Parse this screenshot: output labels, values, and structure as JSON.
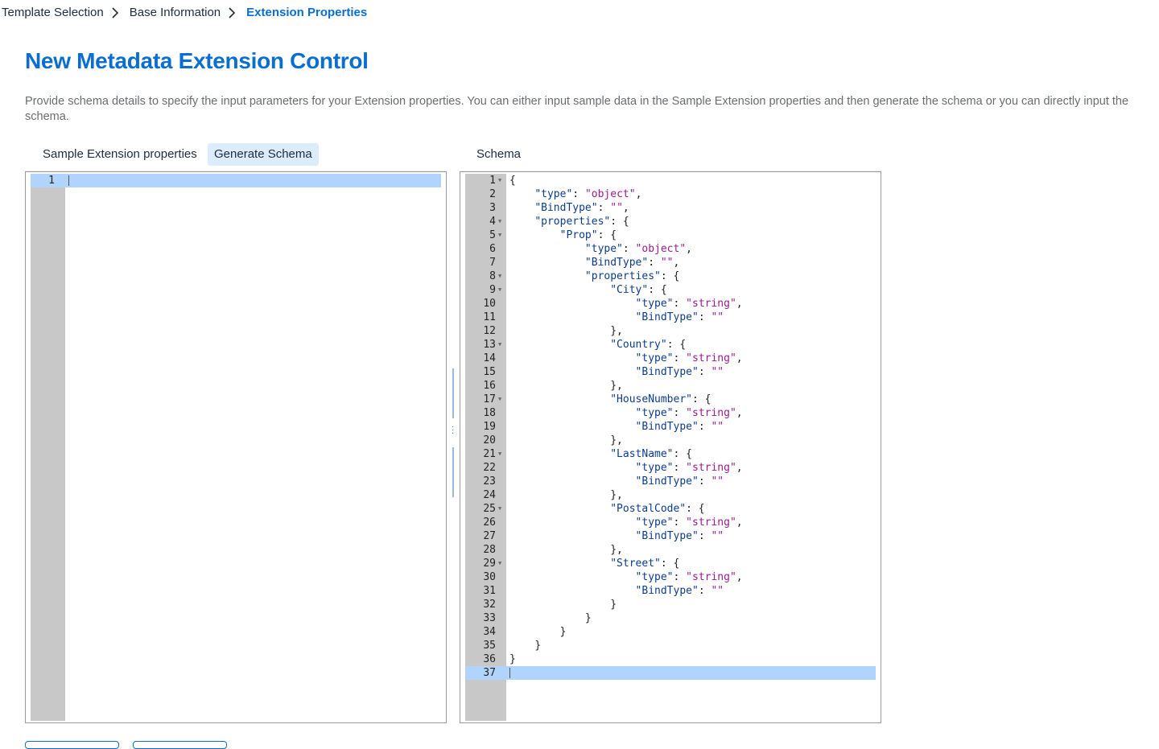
{
  "breadcrumb": {
    "items": [
      "Template Selection",
      "Base Information"
    ],
    "current": "Extension Properties"
  },
  "page": {
    "title": "New Metadata Extension Control",
    "description": "Provide schema details to specify the input parameters for your Extension properties. You can either input sample data in the Sample Extension properties and then generate the schema or you can directly input the schema."
  },
  "left_panel": {
    "tab_label": "Sample Extension properties",
    "generate_button": "Generate Schema",
    "editor": {
      "line_numbers": [
        "1"
      ],
      "active_line": 1
    }
  },
  "right_panel": {
    "tab_label": "Schema",
    "editor": {
      "active_line": 37,
      "lines": [
        {
          "n": "1",
          "fold": true,
          "indent": 0,
          "tokens": [
            [
              "p",
              "{"
            ]
          ]
        },
        {
          "n": "2",
          "indent": 1,
          "tokens": [
            [
              "k",
              "\"type\""
            ],
            [
              "p",
              ": "
            ],
            [
              "s",
              "\"object\""
            ],
            [
              "p",
              ","
            ]
          ]
        },
        {
          "n": "3",
          "indent": 1,
          "tokens": [
            [
              "k",
              "\"BindType\""
            ],
            [
              "p",
              ": "
            ],
            [
              "s",
              "\"\""
            ],
            [
              "p",
              ","
            ]
          ]
        },
        {
          "n": "4",
          "fold": true,
          "indent": 1,
          "tokens": [
            [
              "k",
              "\"properties\""
            ],
            [
              "p",
              ": {"
            ]
          ]
        },
        {
          "n": "5",
          "fold": true,
          "indent": 2,
          "tokens": [
            [
              "k",
              "\"Prop\""
            ],
            [
              "p",
              ": {"
            ]
          ]
        },
        {
          "n": "6",
          "indent": 3,
          "tokens": [
            [
              "k",
              "\"type\""
            ],
            [
              "p",
              ": "
            ],
            [
              "s",
              "\"object\""
            ],
            [
              "p",
              ","
            ]
          ]
        },
        {
          "n": "7",
          "indent": 3,
          "tokens": [
            [
              "k",
              "\"BindType\""
            ],
            [
              "p",
              ": "
            ],
            [
              "s",
              "\"\""
            ],
            [
              "p",
              ","
            ]
          ]
        },
        {
          "n": "8",
          "fold": true,
          "indent": 3,
          "tokens": [
            [
              "k",
              "\"properties\""
            ],
            [
              "p",
              ": {"
            ]
          ]
        },
        {
          "n": "9",
          "fold": true,
          "indent": 4,
          "tokens": [
            [
              "k",
              "\"City\""
            ],
            [
              "p",
              ": {"
            ]
          ]
        },
        {
          "n": "10",
          "indent": 5,
          "tokens": [
            [
              "k",
              "\"type\""
            ],
            [
              "p",
              ": "
            ],
            [
              "s",
              "\"string\""
            ],
            [
              "p",
              ","
            ]
          ]
        },
        {
          "n": "11",
          "indent": 5,
          "tokens": [
            [
              "k",
              "\"BindType\""
            ],
            [
              "p",
              ": "
            ],
            [
              "s",
              "\"\""
            ]
          ]
        },
        {
          "n": "12",
          "indent": 4,
          "tokens": [
            [
              "p",
              "},"
            ]
          ]
        },
        {
          "n": "13",
          "fold": true,
          "indent": 4,
          "tokens": [
            [
              "k",
              "\"Country\""
            ],
            [
              "p",
              ": {"
            ]
          ]
        },
        {
          "n": "14",
          "indent": 5,
          "tokens": [
            [
              "k",
              "\"type\""
            ],
            [
              "p",
              ": "
            ],
            [
              "s",
              "\"string\""
            ],
            [
              "p",
              ","
            ]
          ]
        },
        {
          "n": "15",
          "indent": 5,
          "tokens": [
            [
              "k",
              "\"BindType\""
            ],
            [
              "p",
              ": "
            ],
            [
              "s",
              "\"\""
            ]
          ]
        },
        {
          "n": "16",
          "indent": 4,
          "tokens": [
            [
              "p",
              "},"
            ]
          ]
        },
        {
          "n": "17",
          "fold": true,
          "indent": 4,
          "tokens": [
            [
              "k",
              "\"HouseNumber\""
            ],
            [
              "p",
              ": {"
            ]
          ]
        },
        {
          "n": "18",
          "indent": 5,
          "tokens": [
            [
              "k",
              "\"type\""
            ],
            [
              "p",
              ": "
            ],
            [
              "s",
              "\"string\""
            ],
            [
              "p",
              ","
            ]
          ]
        },
        {
          "n": "19",
          "indent": 5,
          "tokens": [
            [
              "k",
              "\"BindType\""
            ],
            [
              "p",
              ": "
            ],
            [
              "s",
              "\"\""
            ]
          ]
        },
        {
          "n": "20",
          "indent": 4,
          "tokens": [
            [
              "p",
              "},"
            ]
          ]
        },
        {
          "n": "21",
          "fold": true,
          "indent": 4,
          "tokens": [
            [
              "k",
              "\"LastName\""
            ],
            [
              "p",
              ": {"
            ]
          ]
        },
        {
          "n": "22",
          "indent": 5,
          "tokens": [
            [
              "k",
              "\"type\""
            ],
            [
              "p",
              ": "
            ],
            [
              "s",
              "\"string\""
            ],
            [
              "p",
              ","
            ]
          ]
        },
        {
          "n": "23",
          "indent": 5,
          "tokens": [
            [
              "k",
              "\"BindType\""
            ],
            [
              "p",
              ": "
            ],
            [
              "s",
              "\"\""
            ]
          ]
        },
        {
          "n": "24",
          "indent": 4,
          "tokens": [
            [
              "p",
              "},"
            ]
          ]
        },
        {
          "n": "25",
          "fold": true,
          "indent": 4,
          "tokens": [
            [
              "k",
              "\"PostalCode\""
            ],
            [
              "p",
              ": {"
            ]
          ]
        },
        {
          "n": "26",
          "indent": 5,
          "tokens": [
            [
              "k",
              "\"type\""
            ],
            [
              "p",
              ": "
            ],
            [
              "s",
              "\"string\""
            ],
            [
              "p",
              ","
            ]
          ]
        },
        {
          "n": "27",
          "indent": 5,
          "tokens": [
            [
              "k",
              "\"BindType\""
            ],
            [
              "p",
              ": "
            ],
            [
              "s",
              "\"\""
            ]
          ]
        },
        {
          "n": "28",
          "indent": 4,
          "tokens": [
            [
              "p",
              "},"
            ]
          ]
        },
        {
          "n": "29",
          "fold": true,
          "indent": 4,
          "tokens": [
            [
              "k",
              "\"Street\""
            ],
            [
              "p",
              ": {"
            ]
          ]
        },
        {
          "n": "30",
          "indent": 5,
          "tokens": [
            [
              "k",
              "\"type\""
            ],
            [
              "p",
              ": "
            ],
            [
              "s",
              "\"string\""
            ],
            [
              "p",
              ","
            ]
          ]
        },
        {
          "n": "31",
          "indent": 5,
          "tokens": [
            [
              "k",
              "\"BindType\""
            ],
            [
              "p",
              ": "
            ],
            [
              "s",
              "\"\""
            ]
          ]
        },
        {
          "n": "32",
          "indent": 4,
          "tokens": [
            [
              "p",
              "}"
            ]
          ]
        },
        {
          "n": "33",
          "indent": 3,
          "tokens": [
            [
              "p",
              "}"
            ]
          ]
        },
        {
          "n": "34",
          "indent": 2,
          "tokens": [
            [
              "p",
              "}"
            ]
          ]
        },
        {
          "n": "35",
          "indent": 1,
          "tokens": [
            [
              "p",
              "}"
            ]
          ]
        },
        {
          "n": "36",
          "indent": 0,
          "tokens": [
            [
              "p",
              "}"
            ]
          ]
        },
        {
          "n": "37",
          "indent": 0,
          "tokens": []
        }
      ]
    }
  },
  "colors": {
    "accent": "#0a6ed1",
    "json_key": "#0b3c8c",
    "json_string": "#9e1a8f",
    "active_line": "#b0d4fb",
    "gutter": "#c8c8c8"
  },
  "icons": {
    "breadcrumb_separator": "chevron-right-icon",
    "fold_marker": "caret-down-icon",
    "splitter_grip": "drag-handle-icon"
  }
}
